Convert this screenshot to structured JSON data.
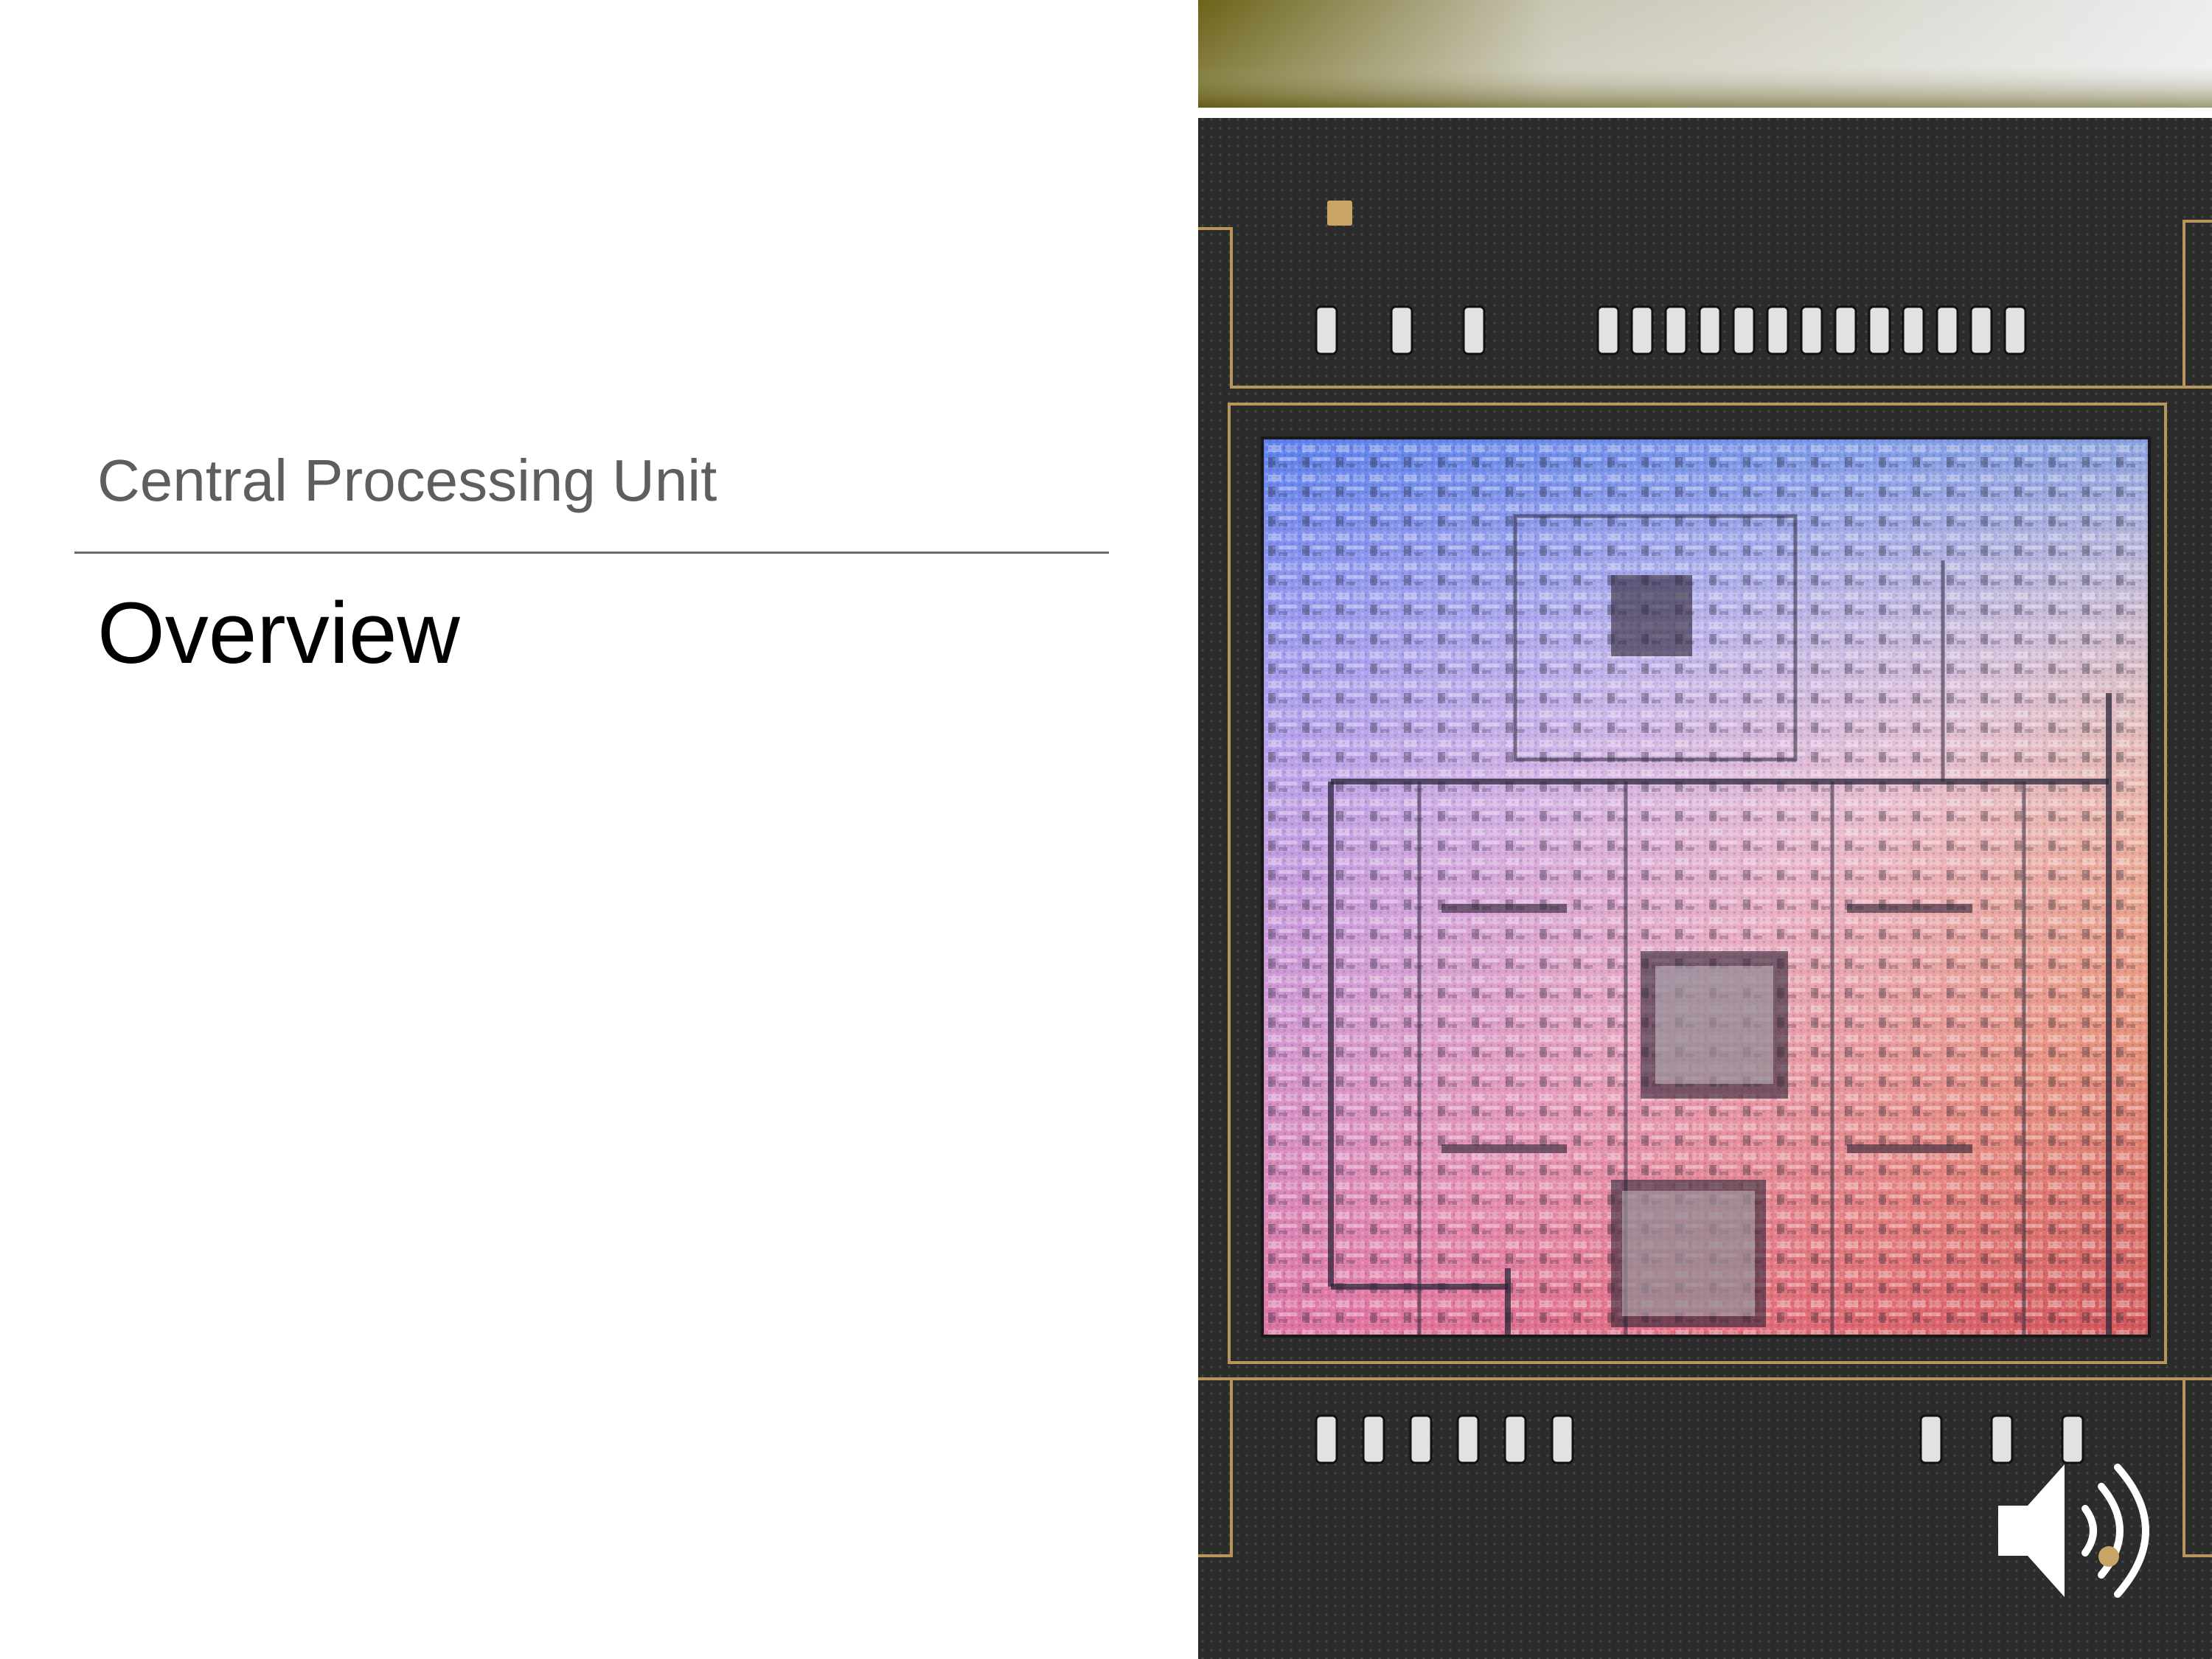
{
  "slide": {
    "section_title": "Central Processing Unit",
    "title": "Overview"
  },
  "image": {
    "description_name": "chip-die-photo"
  },
  "audio": {
    "icon": "speaker-icon"
  },
  "colors": {
    "section_title": "#5e5e5e",
    "title": "#000000",
    "rule": "#6a6a6a",
    "board": "#2b2b2b",
    "gold_trace": "#b8955a",
    "die_blue": "#6f7ef0",
    "die_pink": "#e07fc0",
    "die_orange": "#e6a35a"
  }
}
